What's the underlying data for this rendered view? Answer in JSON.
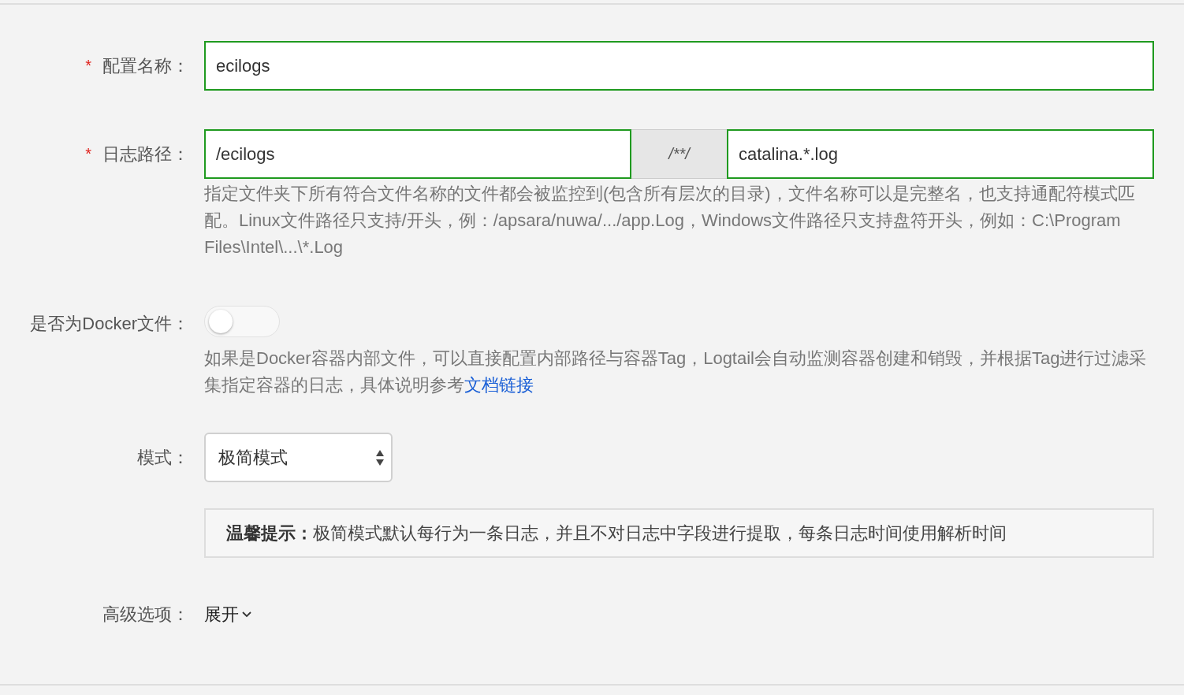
{
  "config_name": {
    "required_mark": "*",
    "label": "配置名称：",
    "value": "ecilogs"
  },
  "log_path": {
    "required_mark": "*",
    "label": "日志路径：",
    "directory": "/ecilogs",
    "separator": "/**/",
    "file_pattern": "catalina.*.log",
    "help": "指定文件夹下所有符合文件名称的文件都会被监控到(包含所有层次的目录)，文件名称可以是完整名，也支持通配符模式匹配。Linux文件路径只支持/开头，例：/apsara/nuwa/.../app.Log，Windows文件路径只支持盘符开头，例如：C:\\Program Files\\Intel\\...\\*.Log"
  },
  "docker": {
    "label": "是否为Docker文件：",
    "on": false,
    "help": "如果是Docker容器内部文件，可以直接配置内部路径与容器Tag，Logtail会自动监测容器创建和销毁，并根据Tag进行过滤采集指定容器的日志，具体说明参考",
    "help_link": "文档链接"
  },
  "mode": {
    "label": "模式：",
    "value": "极简模式"
  },
  "tip": {
    "text": "**温馨提示：**极简模式默认每行为一条日志，并且不对日志中字段进行提取，每条日志时间使用解析时间"
  },
  "advanced": {
    "label": "高级选项：",
    "toggle": "展开",
    "expanded": false
  }
}
